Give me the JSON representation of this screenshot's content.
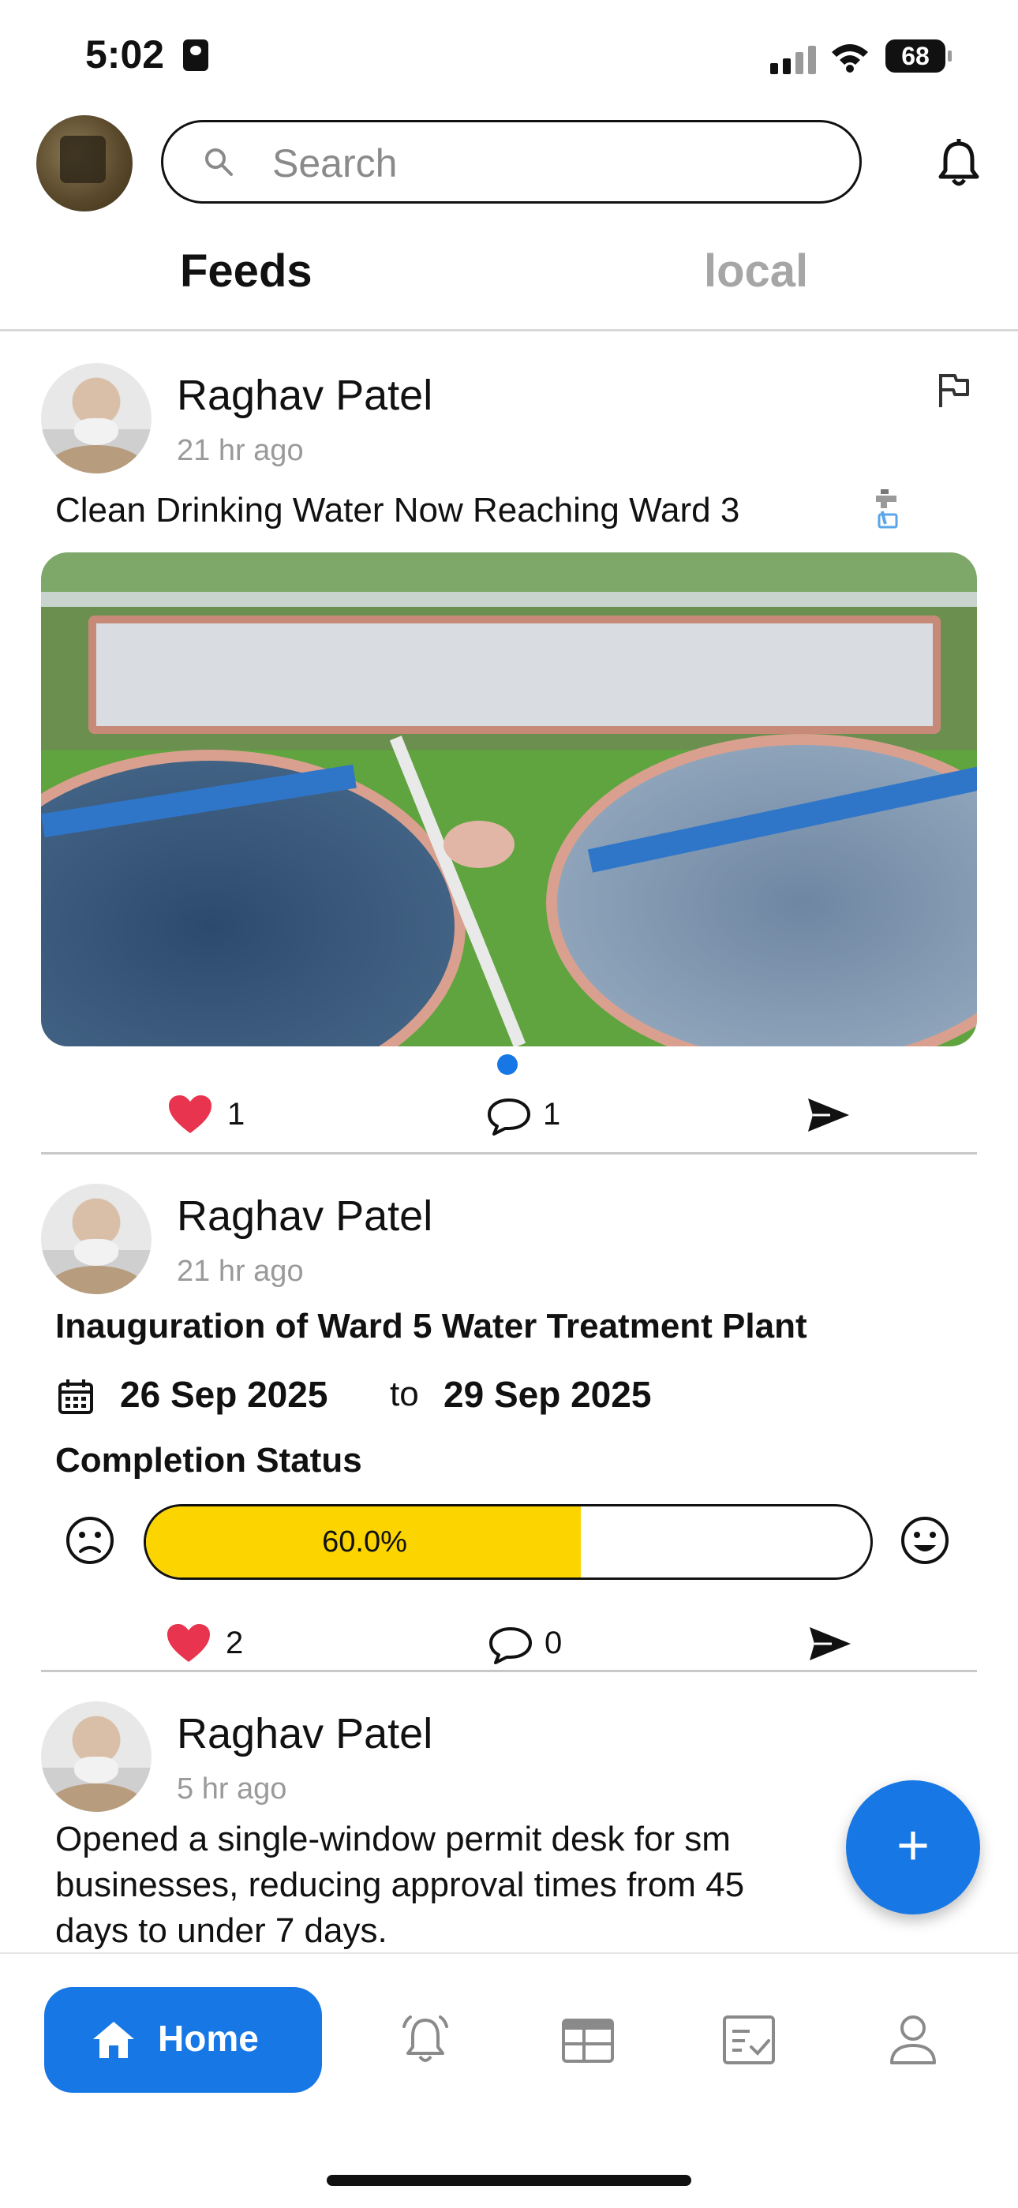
{
  "status_bar": {
    "time": "5:02",
    "battery": "68"
  },
  "header": {
    "search_placeholder": "Search",
    "icons": [
      "search-icon",
      "bell-icon"
    ]
  },
  "tabs": [
    {
      "label": "Feeds",
      "active": true
    },
    {
      "label": "local",
      "active": false
    }
  ],
  "posts": [
    {
      "author": "Raghav Patel",
      "time": "21 hr ago",
      "text": "Clean Drinking Water Now Reaching Ward 3",
      "likes": "1",
      "comments": "1"
    },
    {
      "author": "Raghav Patel",
      "time": "21 hr ago",
      "title": "Inauguration of Ward 5 Water Treatment Plant",
      "start_date": "26 Sep 2025",
      "to_label": "to",
      "end_date": "29 Sep 2025",
      "status_label": "Completion Status",
      "progress_text": "60.0%",
      "progress": 0.6,
      "likes": "2",
      "comments": "0"
    },
    {
      "author": "Raghav Patel",
      "time": "5 hr ago",
      "lines": [
        "Opened a single-window permit desk for sm",
        "businesses, reducing approval times from 45",
        "days to under 7 days."
      ]
    }
  ],
  "fab": {
    "label": "+"
  },
  "bottom_nav": {
    "home_label": "Home",
    "items": [
      "home-icon",
      "notifications-icon",
      "calendar-board-icon",
      "checklist-icon",
      "profile-icon"
    ]
  },
  "colors": {
    "accent": "#1677e5",
    "progress": "#fcd400",
    "heart": "#e8344e"
  }
}
